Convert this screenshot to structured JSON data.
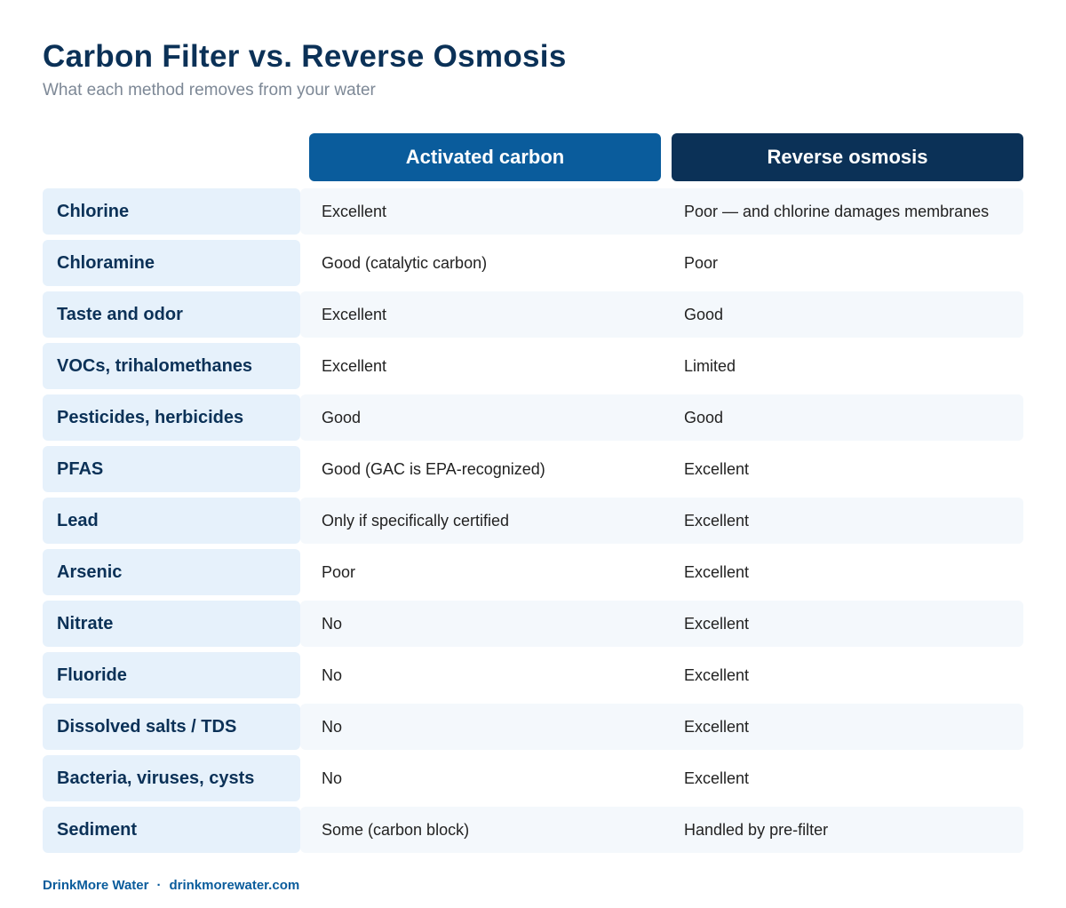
{
  "title": "Carbon Filter vs. Reverse Osmosis",
  "subtitle": "What each method removes from your water",
  "columns": {
    "carbon": "Activated carbon",
    "ro": "Reverse osmosis"
  },
  "rows": [
    {
      "contaminant": "Chlorine",
      "carbon": "Excellent",
      "ro": "Poor — and chlorine damages membranes"
    },
    {
      "contaminant": "Chloramine",
      "carbon": "Good (catalytic carbon)",
      "ro": "Poor"
    },
    {
      "contaminant": "Taste and odor",
      "carbon": "Excellent",
      "ro": "Good"
    },
    {
      "contaminant": "VOCs, trihalomethanes",
      "carbon": "Excellent",
      "ro": "Limited"
    },
    {
      "contaminant": "Pesticides, herbicides",
      "carbon": "Good",
      "ro": "Good"
    },
    {
      "contaminant": "PFAS",
      "carbon": "Good (GAC is EPA-recognized)",
      "ro": "Excellent"
    },
    {
      "contaminant": "Lead",
      "carbon": "Only if specifically certified",
      "ro": "Excellent"
    },
    {
      "contaminant": "Arsenic",
      "carbon": "Poor",
      "ro": "Excellent"
    },
    {
      "contaminant": "Nitrate",
      "carbon": "No",
      "ro": "Excellent"
    },
    {
      "contaminant": "Fluoride",
      "carbon": "No",
      "ro": "Excellent"
    },
    {
      "contaminant": "Dissolved salts / TDS",
      "carbon": "No",
      "ro": "Excellent"
    },
    {
      "contaminant": "Bacteria, viruses, cysts",
      "carbon": "No",
      "ro": "Excellent"
    },
    {
      "contaminant": "Sediment",
      "carbon": "Some (carbon block)",
      "ro": "Handled by pre-filter"
    }
  ],
  "footer": {
    "brand": "DrinkMore Water",
    "separator": "·",
    "site": "drinkmorewater.com"
  },
  "colors": {
    "title": "#0b3157",
    "carbon_header": "#0a5c9c",
    "ro_header": "#0b3157",
    "label_background": "#e6f1fb",
    "alt_row_background": "#f4f8fc"
  }
}
